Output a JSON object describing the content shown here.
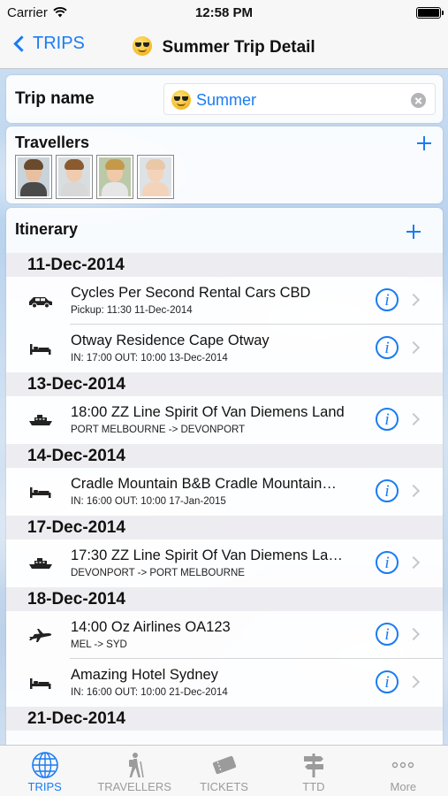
{
  "status": {
    "carrier": "Carrier",
    "time": "12:58 PM"
  },
  "nav": {
    "back_label": "TRIPS",
    "title": "Summer Trip Detail"
  },
  "trip": {
    "label": "Trip name",
    "value": "Summer"
  },
  "travellers": {
    "title": "Travellers",
    "avatars": [
      {
        "name": "traveller-man",
        "hair": "#6a4a2c",
        "skin": "#e8bfa0",
        "shirt": "#4a4a4a"
      },
      {
        "name": "traveller-woman",
        "hair": "#8a5a30",
        "skin": "#f1cbb0",
        "shirt": "#d8d8d8"
      },
      {
        "name": "traveller-boy",
        "hair": "#c49a4a",
        "skin": "#f0c9a8",
        "shirt": "#e6e6e6"
      },
      {
        "name": "traveller-baby",
        "hair": "#e8c8a8",
        "skin": "#f4d3bb",
        "shirt": "#f4d3bb"
      }
    ]
  },
  "itinerary": {
    "title": "Itinerary",
    "groups": [
      {
        "date": "11-Dec-2014",
        "items": [
          {
            "icon": "car-icon",
            "title": "Cycles Per Second Rental Cars CBD",
            "subtitle": "Pickup: 11:30 11-Dec-2014"
          },
          {
            "icon": "bed-icon",
            "title": "Otway Residence  Cape Otway",
            "subtitle": "IN: 17:00  OUT: 10:00 13-Dec-2014"
          }
        ]
      },
      {
        "date": "13-Dec-2014",
        "items": [
          {
            "icon": "ship-icon",
            "title": "18:00 ZZ Line Spirit Of Van Diemens Land",
            "subtitle": "PORT MELBOURNE -> DEVONPORT"
          }
        ]
      },
      {
        "date": "14-Dec-2014",
        "items": [
          {
            "icon": "bed-icon",
            "title": "Cradle Mountain B&B Cradle Mountain…",
            "subtitle": "IN: 16:00  OUT: 10:00 17-Jan-2015"
          }
        ]
      },
      {
        "date": "17-Dec-2014",
        "items": [
          {
            "icon": "ship-icon",
            "title": "17:30 ZZ Line Spirit Of Van Diemens La…",
            "subtitle": "DEVONPORT -> PORT MELBOURNE"
          }
        ]
      },
      {
        "date": "18-Dec-2014",
        "items": [
          {
            "icon": "plane-icon",
            "title": "14:00 Oz Airlines OA123",
            "subtitle": "MEL -> SYD"
          },
          {
            "icon": "bed-icon",
            "title": "Amazing Hotel Sydney",
            "subtitle": "IN: 16:00  OUT: 10:00 21-Dec-2014"
          }
        ]
      },
      {
        "date": "21-Dec-2014",
        "items": []
      }
    ]
  },
  "tabs": [
    {
      "label": "TRIPS",
      "icon": "globe-icon",
      "active": true
    },
    {
      "label": "TRAVELLERS",
      "icon": "hiker-icon",
      "active": false
    },
    {
      "label": "TICKETS",
      "icon": "tickets-icon",
      "active": false
    },
    {
      "label": "TTD",
      "icon": "signpost-icon",
      "active": false
    },
    {
      "label": "More",
      "icon": "more-icon",
      "active": false
    }
  ],
  "colors": {
    "accent": "#1a7cf2",
    "inactive": "#9b9b9b"
  }
}
